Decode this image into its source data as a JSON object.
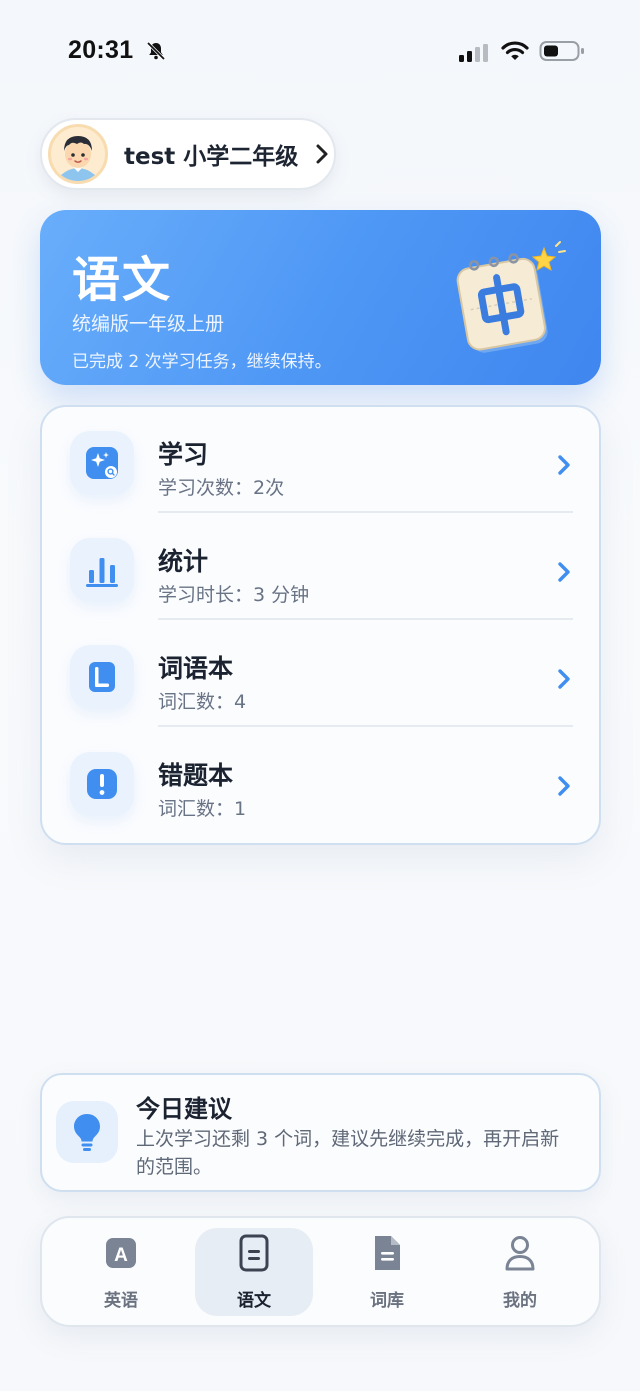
{
  "status_bar": {
    "time": "20:31"
  },
  "profile": {
    "name": "test 小学二年级"
  },
  "subject": {
    "title": "语文",
    "edition": "统编版一年级上册",
    "progress": "已完成 2 次学习任务，继续保持。"
  },
  "menu": {
    "items": [
      {
        "title": "学习",
        "subtitle": "学习次数：2次",
        "icon": "sparkle-search-icon"
      },
      {
        "title": "统计",
        "subtitle": "学习时长：3 分钟",
        "icon": "bar-chart-icon"
      },
      {
        "title": "词语本",
        "subtitle": "词汇数：4",
        "icon": "notebook-icon"
      },
      {
        "title": "错题本",
        "subtitle": "词汇数：1",
        "icon": "exclamation-icon"
      }
    ]
  },
  "tip": {
    "title": "今日建议",
    "text": "上次学习还剩 3 个词，建议先继续完成，再开启新的范围。"
  },
  "tab_bar": {
    "tabs": [
      {
        "label": "英语",
        "icon": "letter-a-icon"
      },
      {
        "label": "语文",
        "icon": "document-icon",
        "active": true
      },
      {
        "label": "词库",
        "icon": "file-icon"
      },
      {
        "label": "我的",
        "icon": "person-icon"
      }
    ]
  },
  "colors": {
    "accent": "#4f98f5",
    "background": "#f6f8fb"
  }
}
